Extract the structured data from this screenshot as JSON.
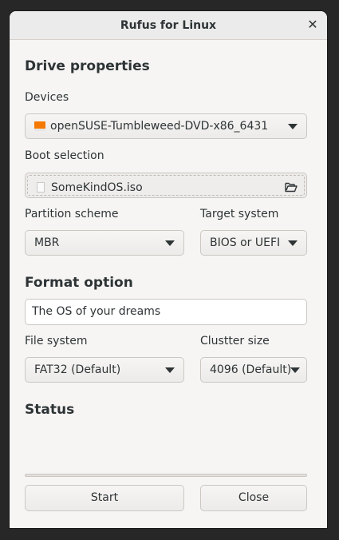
{
  "window": {
    "title": "Rufus for Linux",
    "close_glyph": "✕"
  },
  "drive_properties": {
    "title": "Drive properties",
    "devices_label": "Devices",
    "device_value": "openSUSE-Tumbleweed-DVD-x86_6431",
    "boot_selection_label": "Boot selection",
    "boot_file": "SomeKindOS.iso",
    "partition_scheme_label": "Partition scheme",
    "partition_scheme_value": "MBR",
    "target_system_label": "Target system",
    "target_system_value": "BIOS or UEFI"
  },
  "format_option": {
    "title": "Format option",
    "volume_label_value": "The OS of your dreams",
    "file_system_label": "File system",
    "file_system_value": "FAT32 (Default)",
    "cluster_size_label": "Clustter size",
    "cluster_size_value": "4096 (Default)"
  },
  "status": {
    "title": "Status",
    "progress": 0
  },
  "buttons": {
    "start": "Start",
    "close": "Close"
  },
  "colors": {
    "drive_icon": "#f57900",
    "window_bg": "#f6f5f4",
    "titlebar_bg": "#ebebeb"
  },
  "icons": {
    "drive": "usb-drive-icon",
    "file": "file-icon",
    "open": "folder-open-icon",
    "dropdown": "chevron-down-icon",
    "close": "close-icon"
  }
}
